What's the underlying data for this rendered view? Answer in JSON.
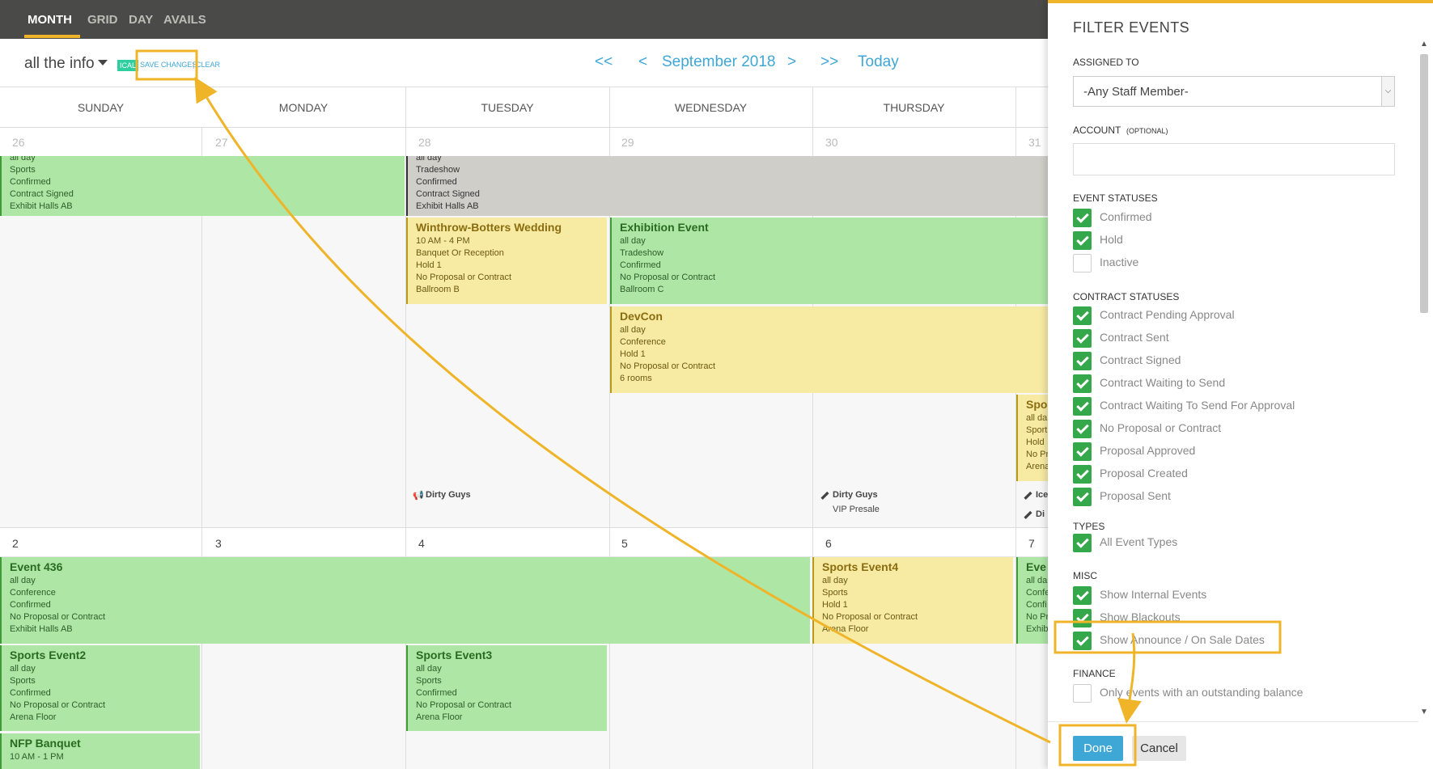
{
  "nav": {
    "tabs": [
      "MONTH",
      "GRID",
      "DAY",
      "AVAILS"
    ],
    "active_tab": "MONTH"
  },
  "toolbar": {
    "calendar_name": "all the info",
    "ical": "ICAL",
    "save_changes": "SAVE CHANGES",
    "separator": "|",
    "clear": "CLEAR",
    "first": "<<",
    "prev": "<",
    "month": "September 2018",
    "next": ">",
    "last": ">>",
    "today": "Today"
  },
  "calendar": {
    "days_of_week": [
      "SUNDAY",
      "MONDAY",
      "TUESDAY",
      "WEDNESDAY",
      "THURSDAY"
    ],
    "week1_days": [
      "26",
      "27",
      "28",
      "29",
      "30",
      "31"
    ],
    "week2_days": [
      "2",
      "3",
      "4",
      "5",
      "6",
      "7"
    ],
    "events": {
      "sports_partial": {
        "lines": [
          "all day",
          "Sports",
          "Confirmed",
          "Contract Signed",
          "Exhibit Halls AB"
        ]
      },
      "tradeshow_partial": {
        "lines": [
          "all day",
          "Tradeshow",
          "Confirmed",
          "Contract Signed",
          "Exhibit Halls AB"
        ]
      },
      "winthrow": {
        "title": "Winthrow-Botters Wedding",
        "lines": [
          "10 AM - 4 PM",
          "Banquet Or Reception",
          "Hold 1",
          "No Proposal or Contract",
          "Ballroom B"
        ]
      },
      "exhibition": {
        "title": "Exhibition Event",
        "lines": [
          "all day",
          "Tradeshow",
          "Confirmed",
          "No Proposal or Contract",
          "Ballroom C"
        ]
      },
      "devcon": {
        "title": "DevCon",
        "lines": [
          "all day",
          "Conference",
          "Hold 1",
          "No Proposal or Contract",
          "6 rooms"
        ]
      },
      "spo_partial": {
        "title": "Spo",
        "lines": [
          "all da",
          "Sport",
          "Hold",
          "No Pr",
          "Arena"
        ]
      },
      "event436": {
        "title": "Event 436",
        "lines": [
          "all day",
          "Conference",
          "Confirmed",
          "No Proposal or Contract",
          "Exhibit Halls AB"
        ]
      },
      "sports_event4": {
        "title": "Sports Event4",
        "lines": [
          "all day",
          "Sports",
          "Hold 1",
          "No Proposal or Contract",
          "Arena Floor"
        ]
      },
      "eve_partial": {
        "title": "Eve",
        "lines": [
          "all da",
          "Confe",
          "Confi",
          "No Pr",
          "Exhib"
        ]
      },
      "sports_event2": {
        "title": "Sports Event2",
        "lines": [
          "all day",
          "Sports",
          "Confirmed",
          "No Proposal or Contract",
          "Arena Floor"
        ]
      },
      "sports_event3": {
        "title": "Sports Event3",
        "lines": [
          "all day",
          "Sports",
          "Confirmed",
          "No Proposal or Contract",
          "Arena Floor"
        ]
      },
      "nfp_banquet": {
        "title": "NFP Banquet",
        "lines": [
          "10 AM - 1 PM"
        ]
      }
    },
    "announcements": {
      "tue": "Dirty Guys",
      "thu": "Dirty Guys",
      "thu_sub": "VIP Presale",
      "fri1": "Ice",
      "fri2": "Di"
    }
  },
  "filter": {
    "title": "FILTER EVENTS",
    "assigned_to_label": "ASSIGNED TO",
    "assigned_to_value": "-Any Staff Member-",
    "account_label": "ACCOUNT",
    "account_optional": "(OPTIONAL)",
    "event_statuses_label": "EVENT STATUSES",
    "event_statuses": [
      {
        "label": "Confirmed",
        "checked": true
      },
      {
        "label": "Hold",
        "checked": true
      },
      {
        "label": "Inactive",
        "checked": false
      }
    ],
    "contract_statuses_label": "CONTRACT STATUSES",
    "contract_statuses": [
      {
        "label": "Contract Pending Approval",
        "checked": true
      },
      {
        "label": "Contract Sent",
        "checked": true
      },
      {
        "label": "Contract Signed",
        "checked": true
      },
      {
        "label": "Contract Waiting to Send",
        "checked": true
      },
      {
        "label": "Contract Waiting To Send For Approval",
        "checked": true
      },
      {
        "label": "No Proposal or Contract",
        "checked": true
      },
      {
        "label": "Proposal Approved",
        "checked": true
      },
      {
        "label": "Proposal Created",
        "checked": true
      },
      {
        "label": "Proposal Sent",
        "checked": true
      }
    ],
    "types_label": "TYPES",
    "types": [
      {
        "label": "All Event Types",
        "checked": true
      }
    ],
    "misc_label": "MISC",
    "misc": [
      {
        "label": "Show Internal Events",
        "checked": true
      },
      {
        "label": "Show Blackouts",
        "checked": true
      },
      {
        "label": "Show Announce / On Sale Dates",
        "checked": true
      }
    ],
    "finance_label": "FINANCE",
    "finance": [
      {
        "label": "Only events with an outstanding balance",
        "checked": false
      }
    ],
    "done": "Done",
    "cancel": "Cancel"
  },
  "colors": {
    "accent": "#f0b429",
    "link": "#3fa7d6",
    "checkbox": "#34a84a",
    "event_green": "#ade6a5",
    "event_yellow": "#f7eaa3",
    "event_gray": "#d0cec8"
  }
}
